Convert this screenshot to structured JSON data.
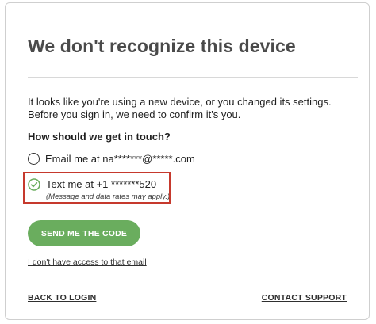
{
  "title": "We don't recognize this device",
  "intro": "It looks like you're using a new device, or you changed its settings. Before you sign in, we need to confirm it's you.",
  "question": "How should we get in touch?",
  "options": [
    {
      "label": "Email me at na*******@*****.com",
      "selected": false
    },
    {
      "label": "Text me at +1 *******520",
      "note": "(Message and data rates may apply.)",
      "selected": true
    }
  ],
  "send_button_label": "SEND ME THE CODE",
  "no_access_link": "I don't have access to that email",
  "footer": {
    "back_label": "BACK TO LOGIN",
    "support_label": "CONTACT SUPPORT"
  },
  "colors": {
    "accent_green": "#6aad5e",
    "highlight_red": "#c6392d"
  },
  "icons": {
    "unselected": "radio-unchecked-icon",
    "selected": "check-circle-icon"
  }
}
